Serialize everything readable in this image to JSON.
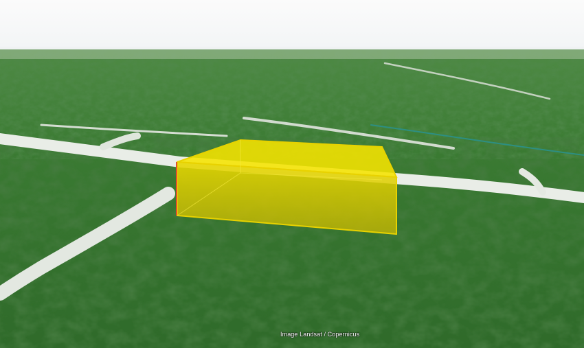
{
  "map": {
    "attribution": "Image Landsat / Copernicus",
    "colors": {
      "sky": "#f4f6f7",
      "forest_dark": "#1d4a1b",
      "forest_mid": "#2f6b28",
      "forest_light": "#4a8c3c",
      "road": "#e7ebe6",
      "box_fill": "#f5e400",
      "box_edge": "#e8d200",
      "box_edge_red": "#e0522a"
    },
    "overlay": {
      "type": "extruded-polygon",
      "color": "#f5e400"
    }
  }
}
